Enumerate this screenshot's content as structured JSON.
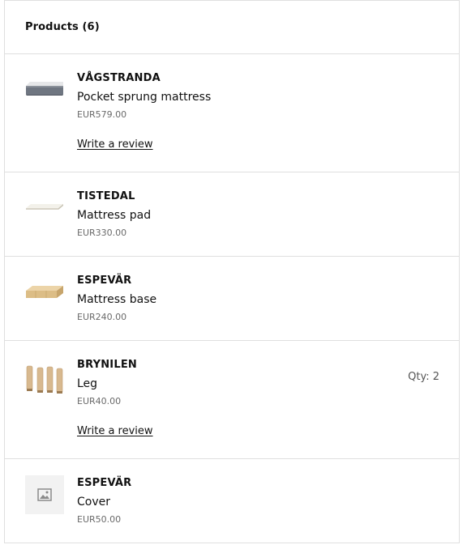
{
  "header": {
    "title": "Products (6)"
  },
  "products": [
    {
      "name": "VÅGSTRANDA",
      "description": "Pocket sprung mattress",
      "price": "EUR579.00",
      "review_label": "Write a review",
      "image": "mattress-image"
    },
    {
      "name": "TISTEDAL",
      "description": "Mattress pad",
      "price": "EUR330.00",
      "image": "mattress-pad-image"
    },
    {
      "name": "ESPEVÄR",
      "description": "Mattress base",
      "price": "EUR240.00",
      "image": "mattress-base-image"
    },
    {
      "name": "BRYNILEN",
      "description": "Leg",
      "price": "EUR40.00",
      "quantity": "Qty: 2",
      "review_label": "Write a review",
      "image": "legs-image"
    },
    {
      "name": "ESPEVÄR",
      "description": "Cover",
      "price": "EUR50.00",
      "image": "image-placeholder-icon"
    }
  ]
}
